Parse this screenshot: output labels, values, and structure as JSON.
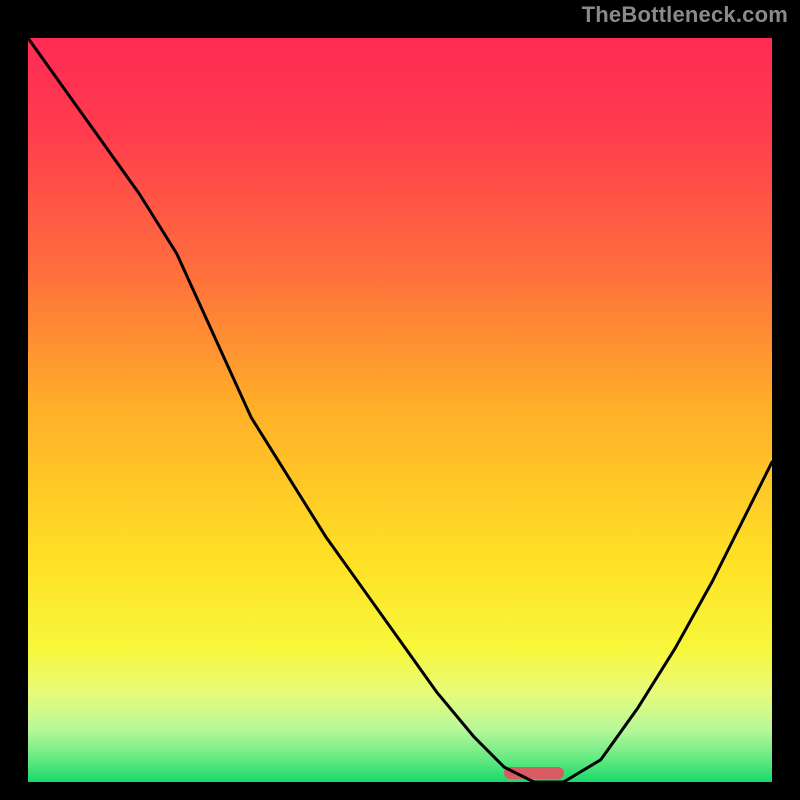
{
  "watermark": "TheBottleneck.com",
  "chart_data": {
    "type": "line",
    "title": "",
    "xlabel": "",
    "ylabel": "",
    "xlim": [
      0,
      100
    ],
    "ylim": [
      0,
      100
    ],
    "x": [
      0,
      5,
      10,
      15,
      20,
      25,
      30,
      35,
      40,
      45,
      50,
      55,
      60,
      64,
      68,
      72,
      77,
      82,
      87,
      92,
      97,
      100
    ],
    "values": [
      100,
      93,
      86,
      79,
      71,
      60,
      49,
      41,
      33,
      26,
      19,
      12,
      6,
      2,
      0,
      0,
      3,
      10,
      18,
      27,
      37,
      43
    ],
    "minimum_band": {
      "x_pct": [
        64,
        72
      ],
      "y_pct": 0
    },
    "marker_color": "#d85a62",
    "gradient_stops": [
      {
        "pct": 0,
        "color": "#ff2b54"
      },
      {
        "pct": 12,
        "color": "#ff3b4e"
      },
      {
        "pct": 30,
        "color": "#ff6a3e"
      },
      {
        "pct": 50,
        "color": "#ffb028"
      },
      {
        "pct": 70,
        "color": "#ffe026"
      },
      {
        "pct": 82,
        "color": "#f7f73a"
      },
      {
        "pct": 88,
        "color": "#e8fb7a"
      },
      {
        "pct": 93,
        "color": "#b6f89a"
      },
      {
        "pct": 97,
        "color": "#63e981"
      },
      {
        "pct": 100,
        "color": "#18d86a"
      }
    ]
  }
}
